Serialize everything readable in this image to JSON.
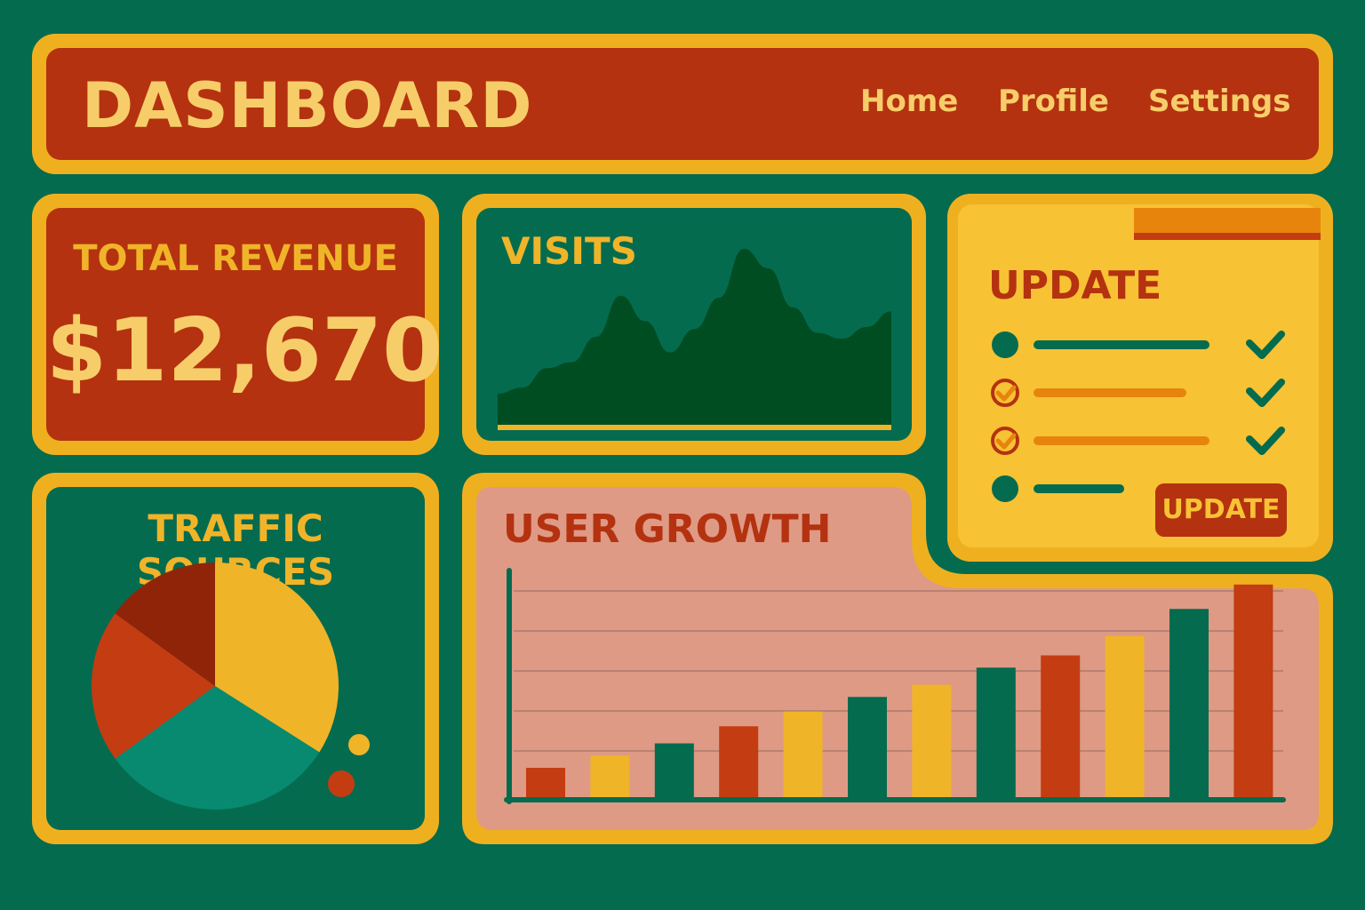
{
  "header": {
    "title": "DASHBOARD",
    "nav": [
      {
        "label": "Home"
      },
      {
        "label": "Profile"
      },
      {
        "label": "Settings"
      }
    ]
  },
  "revenue": {
    "title": "TOTAL REVENUE",
    "value": "$12,670"
  },
  "visits": {
    "title": "VISITS"
  },
  "update": {
    "title": "UPDATE",
    "button_label": "UPDATE",
    "items": [
      {
        "bullet": "dot",
        "color": "#046b4f",
        "checked": true
      },
      {
        "bullet": "check-circle",
        "color": "#e7840c",
        "checked": true
      },
      {
        "bullet": "check-circle",
        "color": "#e7840c",
        "checked": true
      },
      {
        "bullet": "dot",
        "color": "#046b4f",
        "checked": false
      }
    ]
  },
  "traffic": {
    "title": "TRAFFIC SOURCES"
  },
  "growth": {
    "title": "USER GROWTH"
  },
  "colors": {
    "background": "#046b4f",
    "frame": "#efb020",
    "red": "#b43210",
    "orange": "#e7840c",
    "yellow": "#f0b429",
    "green": "#046b4f",
    "teal": "#078a70",
    "maroon": "#8f2408",
    "pink": "#de9a84",
    "dark_green": "#004d22"
  },
  "chart_data": [
    {
      "type": "area",
      "title": "VISITS",
      "x": [
        0,
        1,
        2,
        3,
        4,
        5,
        6,
        7,
        8,
        9,
        10,
        11,
        12,
        13,
        14,
        15,
        16
      ],
      "values": [
        16,
        19,
        29,
        32,
        45,
        66,
        53,
        37,
        49,
        65,
        90,
        80,
        60,
        47,
        44,
        50,
        58
      ],
      "ylim": [
        0,
        100
      ],
      "grid": false
    },
    {
      "type": "pie",
      "title": "TRAFFIC SOURCES",
      "values": [
        34,
        31,
        20,
        15
      ],
      "colors": [
        "#f0b429",
        "#078a70",
        "#c43c12",
        "#8f2408"
      ]
    },
    {
      "type": "bar",
      "title": "USER GROWTH",
      "categories": [
        "",
        "",
        "",
        "",
        "",
        "",
        "",
        "",
        "",
        "",
        "",
        ""
      ],
      "values": [
        12,
        17,
        22,
        29,
        35,
        41,
        46,
        53,
        58,
        66,
        77,
        87
      ],
      "colors": [
        "#c43c12",
        "#f0b429",
        "#046b4f",
        "#c43c12",
        "#f0b429",
        "#046b4f",
        "#f0b429",
        "#046b4f",
        "#c43c12",
        "#f0b429",
        "#046b4f",
        "#c43c12"
      ],
      "ylim": [
        0,
        100
      ],
      "grid": true
    }
  ]
}
